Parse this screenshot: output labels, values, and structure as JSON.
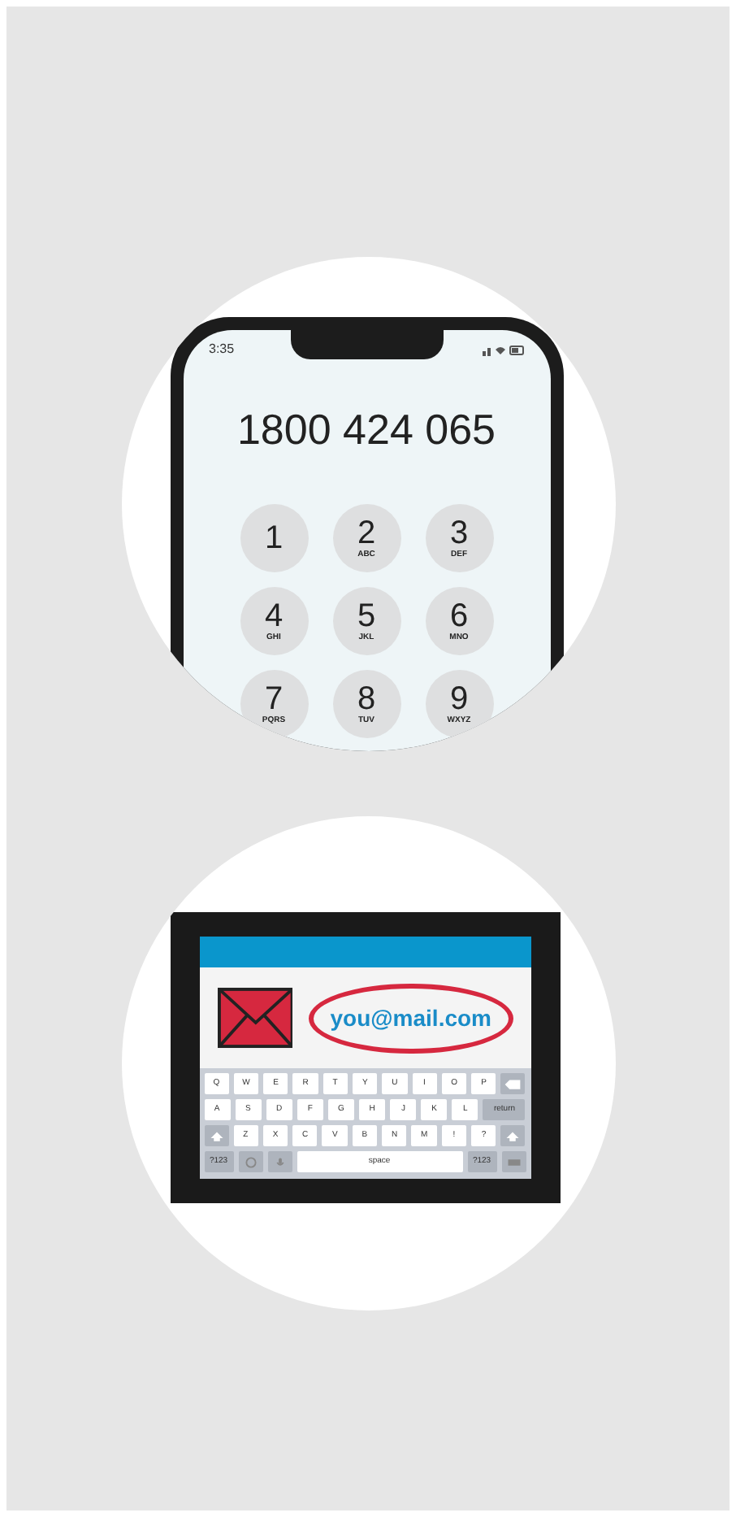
{
  "dialer": {
    "status_time": "3:35",
    "number": "1800 424 065",
    "keys": [
      {
        "digit": "1"
      },
      {
        "digit": "2",
        "letters": "ABC"
      },
      {
        "digit": "3",
        "letters": "DEF"
      },
      {
        "digit": "4",
        "letters": "GHI"
      },
      {
        "digit": "5",
        "letters": "JKL"
      },
      {
        "digit": "6",
        "letters": "MNO"
      },
      {
        "digit": "7",
        "letters": "PQRS"
      },
      {
        "digit": "8",
        "letters": "TUV"
      },
      {
        "digit": "9",
        "letters": "WXYZ"
      }
    ]
  },
  "email": {
    "address": "you@mail.com",
    "keyboard_rows": [
      [
        {
          "kind": "char",
          "label": "Q"
        },
        {
          "kind": "char",
          "label": "W"
        },
        {
          "kind": "char",
          "label": "E"
        },
        {
          "kind": "char",
          "label": "R"
        },
        {
          "kind": "char",
          "label": "T"
        },
        {
          "kind": "char",
          "label": "Y"
        },
        {
          "kind": "char",
          "label": "U"
        },
        {
          "kind": "char",
          "label": "I"
        },
        {
          "kind": "char",
          "label": "O"
        },
        {
          "kind": "char",
          "label": "P"
        },
        {
          "kind": "backspace"
        }
      ],
      [
        {
          "kind": "char",
          "label": "A"
        },
        {
          "kind": "char",
          "label": "S"
        },
        {
          "kind": "char",
          "label": "D"
        },
        {
          "kind": "char",
          "label": "F"
        },
        {
          "kind": "char",
          "label": "G"
        },
        {
          "kind": "char",
          "label": "H"
        },
        {
          "kind": "char",
          "label": "J"
        },
        {
          "kind": "char",
          "label": "K"
        },
        {
          "kind": "char",
          "label": "L"
        },
        {
          "kind": "wide",
          "label": "return"
        }
      ],
      [
        {
          "kind": "shift"
        },
        {
          "kind": "char",
          "label": "Z"
        },
        {
          "kind": "char",
          "label": "X"
        },
        {
          "kind": "char",
          "label": "C"
        },
        {
          "kind": "char",
          "label": "V"
        },
        {
          "kind": "char",
          "label": "B"
        },
        {
          "kind": "char",
          "label": "N"
        },
        {
          "kind": "char",
          "label": "M"
        },
        {
          "kind": "char",
          "label": "!"
        },
        {
          "kind": "char",
          "label": "?"
        },
        {
          "kind": "shift"
        }
      ],
      [
        {
          "kind": "fn",
          "label": "?123"
        },
        {
          "kind": "globe"
        },
        {
          "kind": "mic"
        },
        {
          "kind": "space",
          "label": "space"
        },
        {
          "kind": "fn",
          "label": "?123"
        },
        {
          "kind": "hide"
        }
      ]
    ]
  }
}
